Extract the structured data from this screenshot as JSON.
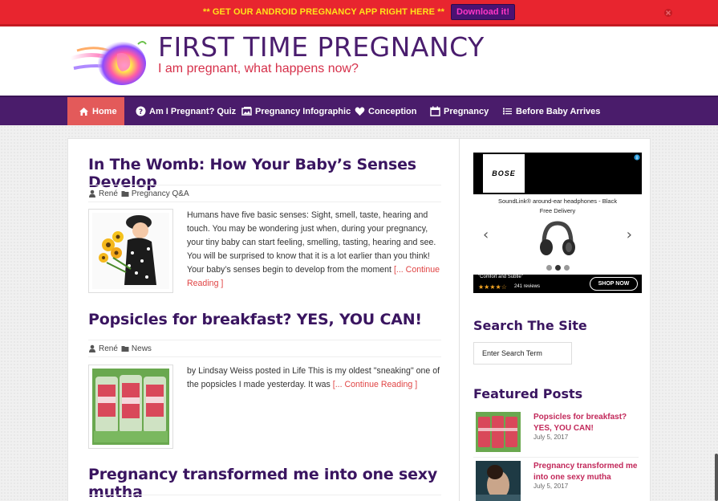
{
  "promo": {
    "text": "** GET OUR ANDROID PREGNANCY APP RIGHT HERE **",
    "button": "Download it!"
  },
  "header": {
    "title": "FIRST TIME PREGNANCY",
    "tagline": "I am pregnant, what happens now?"
  },
  "nav": [
    {
      "label": "Home",
      "icon": "home-icon"
    },
    {
      "label": "Am I Pregnant? Quiz",
      "icon": "question-icon"
    },
    {
      "label": "Pregnancy Infographic",
      "icon": "image-icon"
    },
    {
      "label": "Conception",
      "icon": "heart-icon"
    },
    {
      "label": "Pregnancy",
      "icon": "calendar-icon"
    },
    {
      "label": "Before Baby Arrives",
      "icon": "list-icon"
    }
  ],
  "posts": [
    {
      "title": "In The Womb: How Your Baby’s Senses Develop",
      "author": "René",
      "category": "Pregnancy Q&A",
      "excerpt": "Humans have five basic senses: Sight, smell, taste, hearing and touch. You may be wondering just when, during your pregnancy, your tiny baby can start feeling, smelling, tasting, hearing and see. You will be surprised to know that it is a lot earlier than you think! Your baby’s senses begin to develop from the moment",
      "read_more": "[... Continue Reading ]"
    },
    {
      "title": "Popsicles for breakfast? YES, YOU CAN!",
      "author": "René",
      "category": "News",
      "excerpt": "by Lindsay Weiss posted in Life This is my oldest \"sneaking\" one of the popsicles I made yesterday. It was",
      "read_more": "[... Continue Reading ]"
    },
    {
      "title": "Pregnancy transformed me into one sexy mutha"
    }
  ],
  "ad": {
    "brand": "BOSE",
    "product": "SoundLink® around-ear headphones - Black",
    "shipping": "Free Delivery",
    "quote": "\"Comfort and Subtle\"",
    "reviews": "241 reviews",
    "rating_stars": "★★★★☆",
    "cta": "SHOP NOW"
  },
  "sidebar": {
    "search_title": "Search The Site",
    "search_placeholder": "Enter Search Term",
    "featured_title": "Featured Posts",
    "featured": [
      {
        "title": "Popsicles for breakfast? YES, YOU CAN!",
        "date": "July 5, 2017"
      },
      {
        "title": "Pregnancy transformed me into one sexy mutha",
        "date": "July 5, 2017"
      }
    ]
  }
}
